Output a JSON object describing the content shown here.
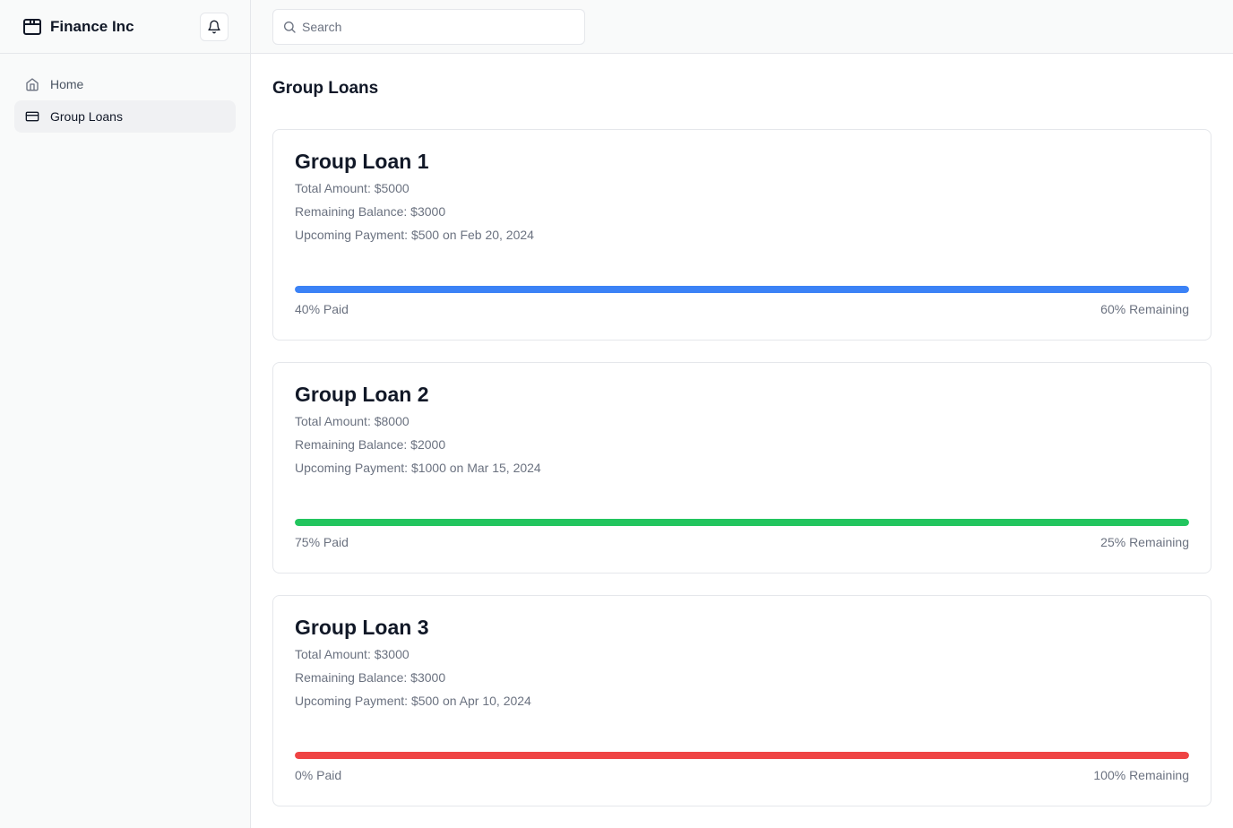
{
  "app": {
    "brand_name": "Finance Inc",
    "brand_icon": "package-icon",
    "notification_icon": "bell-icon"
  },
  "sidebar": {
    "items": [
      {
        "label": "Home",
        "icon": "home-icon",
        "active": false
      },
      {
        "label": "Group Loans",
        "icon": "credit-card-icon",
        "active": true
      }
    ]
  },
  "search": {
    "placeholder": "Search",
    "value": ""
  },
  "page": {
    "title": "Group Loans"
  },
  "loans": [
    {
      "title": "Group Loan 1",
      "total_amount": "Total Amount: $5000",
      "remaining_balance": "Remaining Balance: $3000",
      "upcoming_payment": "Upcoming Payment: $500 on Feb 20, 2024",
      "bar_color": "#3b82f6",
      "paid_label": "40% Paid",
      "remaining_label": "60% Remaining"
    },
    {
      "title": "Group Loan 2",
      "total_amount": "Total Amount: $8000",
      "remaining_balance": "Remaining Balance: $2000",
      "upcoming_payment": "Upcoming Payment: $1000 on Mar 15, 2024",
      "bar_color": "#22c55e",
      "paid_label": "75% Paid",
      "remaining_label": "25% Remaining"
    },
    {
      "title": "Group Loan 3",
      "total_amount": "Total Amount: $3000",
      "remaining_balance": "Remaining Balance: $3000",
      "upcoming_payment": "Upcoming Payment: $500 on Apr 10, 2024",
      "bar_color": "#ef4444",
      "paid_label": "0% Paid",
      "remaining_label": "100% Remaining"
    }
  ]
}
